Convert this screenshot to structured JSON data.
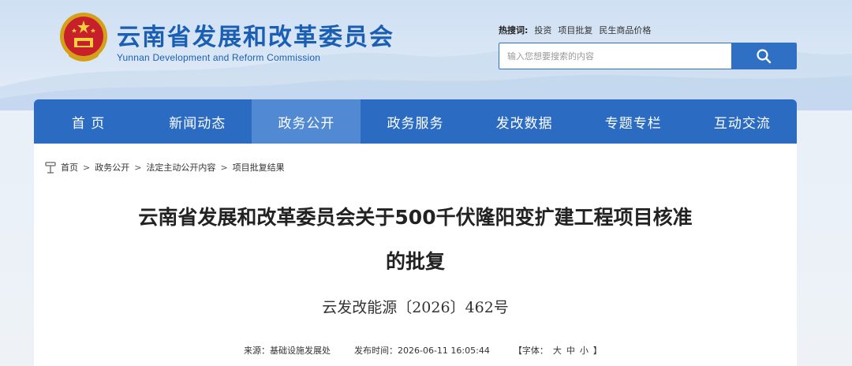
{
  "header": {
    "title": "云南省发展和改革委员会",
    "subtitle": "Yunnan Development and Reform Commission",
    "hot_search": {
      "label": "热搜词:",
      "links": [
        "投资",
        "项目批复",
        "民生商品价格"
      ]
    },
    "search": {
      "placeholder": "输入您想要搜索的内容",
      "icon": "search-icon"
    }
  },
  "nav": {
    "items": [
      {
        "label": "首 页",
        "active": false
      },
      {
        "label": "新闻动态",
        "active": false
      },
      {
        "label": "政务公开",
        "active": true
      },
      {
        "label": "政务服务",
        "active": false
      },
      {
        "label": "发改数据",
        "active": false
      },
      {
        "label": "专题专栏",
        "active": false
      },
      {
        "label": "互动交流",
        "active": false
      }
    ]
  },
  "breadcrumb": {
    "icon": "location-icon",
    "items": [
      "首页",
      "政务公开",
      "法定主动公开内容",
      "项目批复结果"
    ],
    "separator": ">"
  },
  "article": {
    "title_line1": "云南省发展和改革委员会关于500千伏隆阳变扩建工程项目核准",
    "title_line2": "的批复",
    "doc_number": "云发改能源〔2026〕462号",
    "source_label": "来源：",
    "source": "基础设施发展处",
    "publish_label": "发布时间：",
    "publish_time": "2026-06-11 16:05:44",
    "font_label": "【字体：",
    "font_sizes": [
      "大",
      "中",
      "小"
    ],
    "font_close": "】"
  },
  "colors": {
    "brand_blue": "#2b6cc2",
    "nav_active": "#5189d3",
    "title_blue": "#1a5fb4"
  }
}
